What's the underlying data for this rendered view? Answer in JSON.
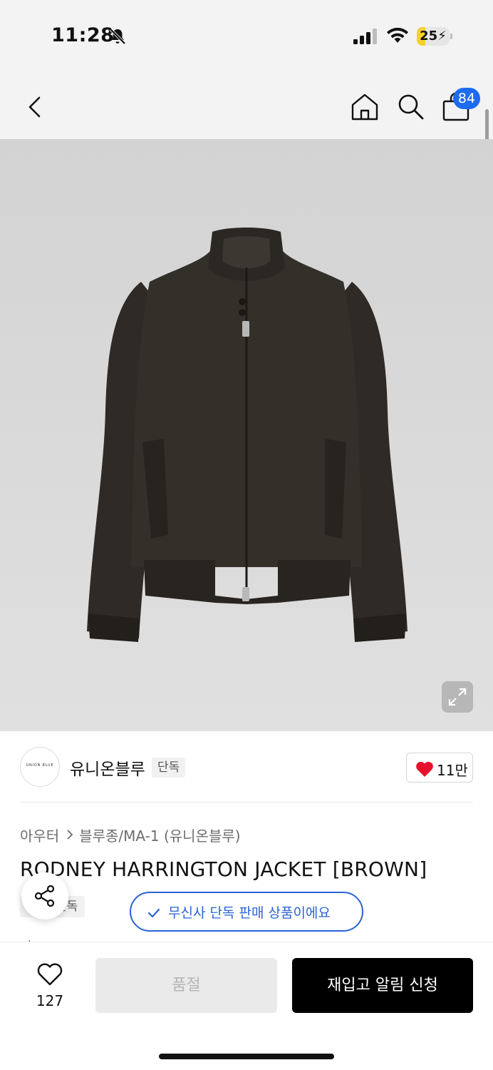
{
  "status_bar": {
    "time": "11:28",
    "battery_level": "25",
    "battery_fraction": 0.25,
    "icons": [
      "bell-slash-icon",
      "signal-icon",
      "wifi-icon",
      "battery-charging-icon"
    ]
  },
  "nav": {
    "back_icon": "chevron-left-icon",
    "home_icon": "home-icon",
    "search_icon": "search-icon",
    "cart_icon": "shopping-bag-icon",
    "cart_count": "84"
  },
  "product_image": {
    "description_icon": "jacket-photo",
    "expand_icon": "expand-icon"
  },
  "brand": {
    "logo_text": "UNION BLUE",
    "name": "유니온블루",
    "tag": "단독",
    "like_count": "11만"
  },
  "breadcrumb": {
    "category": "아우터",
    "subcategory": "블루종/MA-1 (유니온블루)"
  },
  "product": {
    "title": "RODNEY HARRINGTON JACKET [BROWN]",
    "exclusive_tag": "단독",
    "exclusive_notice": "무신사 단독 판매 상품이에요"
  },
  "bottom_bar": {
    "wish_count": "127",
    "soldout_label": "품절",
    "restock_label": "재입고 알림 신청"
  },
  "colors": {
    "accent_blue": "#2a63d6",
    "badge_blue": "#1e6bf0",
    "heart_red": "#e8112d",
    "battery_yellow": "#f6d02f"
  }
}
